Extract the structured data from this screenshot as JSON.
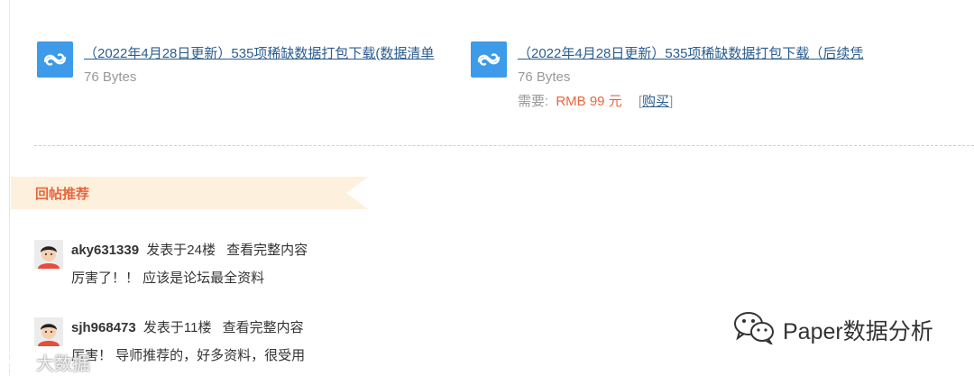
{
  "attachments": [
    {
      "name": "（2022年4月28日更新）535项稀缺数据打包下载(数据清单",
      "size": "76 Bytes"
    },
    {
      "name": "（2022年4月28日更新）535项稀缺数据打包下载（后续凭",
      "size": "76 Bytes",
      "price_label": "需要:",
      "price_value": "RMB 99 元",
      "buy_open": "[",
      "buy_label": "购买",
      "buy_close": "]"
    }
  ],
  "section": {
    "title": "回帖推荐"
  },
  "replies": [
    {
      "user": "aky631339",
      "floor": "发表于24楼",
      "view_full": "查看完整内容",
      "content": "厉害了！！  应该是论坛最全资料"
    },
    {
      "user": "sjh968473",
      "floor": "发表于11楼",
      "view_full": "查看完整内容",
      "content": "厉害！ 导师推荐的，好多资料，很受用"
    }
  ],
  "watermark": {
    "text": "Paper数据分析",
    "icon": "wechat-icon"
  },
  "watermark2": {
    "text": "大数据",
    "icon": "weibo-icon"
  },
  "colors": {
    "link": "#2b5d8f",
    "accent": "#e8663d",
    "banner": "#fdf0dd",
    "cloud": "#3d9be9"
  }
}
